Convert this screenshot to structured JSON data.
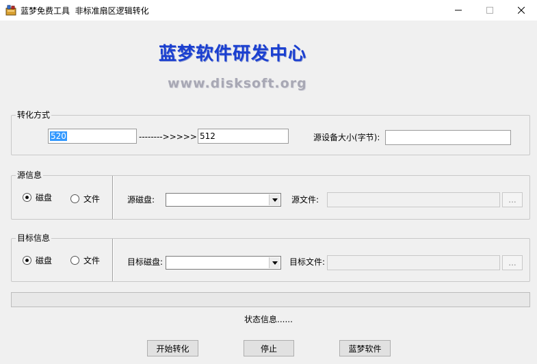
{
  "window": {
    "title": "蓝梦免费工具  非标准扇区逻辑转化",
    "minimize_glyph": "—",
    "maximize_glyph": "☐",
    "close_glyph": "✕"
  },
  "banner": {
    "title": "蓝梦软件研发中心",
    "url": "www.disksoft.org"
  },
  "conversion": {
    "group_label": "转化方式",
    "source_sector_size": "520",
    "arrow_text": "-------->>>>>>",
    "target_sector_size": "512",
    "device_size_label": "源设备大小(字节):",
    "device_size_value": ""
  },
  "source": {
    "group_label": "源信息",
    "radio_disk": "磁盘",
    "radio_file": "文件",
    "selected": "磁盘",
    "disk_label": "源磁盘:",
    "disk_value": "",
    "file_label": "源文件:",
    "file_value": "",
    "browse_label": "..."
  },
  "target": {
    "group_label": "目标信息",
    "radio_disk": "磁盘",
    "radio_file": "文件",
    "selected": "磁盘",
    "disk_label": "目标磁盘:",
    "disk_value": "",
    "file_label": "目标文件:",
    "file_value": "",
    "browse_label": "..."
  },
  "progress": {
    "value_percent": 0
  },
  "status": {
    "text": "状态信息......"
  },
  "buttons": {
    "start": "开始转化",
    "stop": "停止",
    "lanmeng": "蓝梦软件"
  },
  "icons": {
    "app": "app-toolbox-icon",
    "dropdown": "chevron-down-icon"
  }
}
